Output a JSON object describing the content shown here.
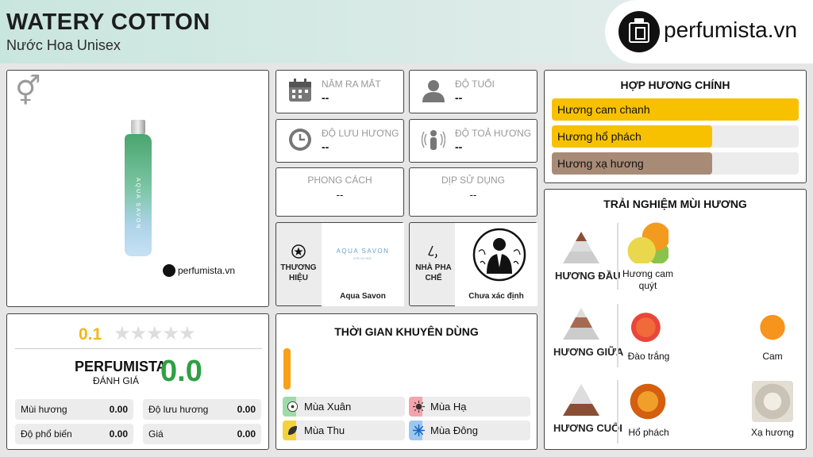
{
  "header": {
    "title": "WATERY COTTON",
    "subtitle": "Nước Hoa Unisex",
    "logo_text": "perfumista.vn"
  },
  "product": {
    "gender_icon": "unisex-gender-icon",
    "bottle_label": "AQUA SAVON",
    "watermark": "perfumista.vn"
  },
  "info": {
    "launch": {
      "label": "NĂM RA MẮT",
      "value": "--",
      "icon": "calendar-icon"
    },
    "age": {
      "label": "ĐỘ TUỔI",
      "value": "--",
      "icon": "person-icon"
    },
    "longevity": {
      "label": "ĐỘ LƯU HƯƠNG",
      "value": "--",
      "icon": "clock-icon"
    },
    "sillage": {
      "label": "ĐỘ TOẢ HƯƠNG",
      "value": "--",
      "icon": "sillage-icon"
    },
    "style": {
      "label": "PHONG CÁCH",
      "value": "--"
    },
    "occasion": {
      "label": "DỊP SỬ DỤNG",
      "value": "--"
    },
    "brand": {
      "label": "THƯƠNG HIỆU",
      "name": "Aqua Savon",
      "logo_text": "AQUA SAVON",
      "logo_sub": "ORIGINE"
    },
    "perfumer": {
      "label": "NHÀ PHA CHẾ",
      "name": "Chưa xác định"
    }
  },
  "accords": {
    "title": "HỢP HƯƠNG CHÍNH",
    "items": [
      {
        "label": "Hương cam chanh",
        "percent": 100,
        "color": "#f7c100"
      },
      {
        "label": "Hương hổ phách",
        "percent": 65,
        "color": "#f7c100"
      },
      {
        "label": "Hương xạ hương",
        "percent": 65,
        "color": "#a88b77"
      }
    ]
  },
  "notes": {
    "title": "TRẢI NGHIỆM MÙI HƯƠNG",
    "layers": [
      {
        "label": "HƯƠNG ĐẦU",
        "notes": [
          "Hương cam quýt"
        ]
      },
      {
        "label": "HƯƠNG GIỮA",
        "notes": [
          "Đào trắng",
          "Cam"
        ]
      },
      {
        "label": "HƯƠNG CUỐI",
        "notes": [
          "Hổ phách",
          "Xạ hương"
        ]
      }
    ]
  },
  "rating": {
    "score": "0.1",
    "stars": 5,
    "stars_filled": 0,
    "perfumista_label": "PERFUMISTA",
    "perfumista_sub": "ĐÁNH GIÁ",
    "perfumista_score": "0.0",
    "metrics": [
      {
        "name": "Mùi hương",
        "value": "0.00"
      },
      {
        "name": "Độ lưu hương",
        "value": "0.00"
      },
      {
        "name": "Độ phổ biến",
        "value": "0.00"
      },
      {
        "name": "Giá",
        "value": "0.00"
      }
    ]
  },
  "seasons": {
    "title": "THỜI GIAN KHUYÊN DÙNG",
    "indicator_color": "#f7a11a",
    "items": [
      {
        "label": "Mùa Xuân",
        "color": "#9fdba8"
      },
      {
        "label": "Mùa Hạ",
        "color": "#f6a3ad"
      },
      {
        "label": "Mùa Thu",
        "color": "#f4d23c"
      },
      {
        "label": "Mùa Đông",
        "color": "#9cc8f0"
      }
    ]
  }
}
